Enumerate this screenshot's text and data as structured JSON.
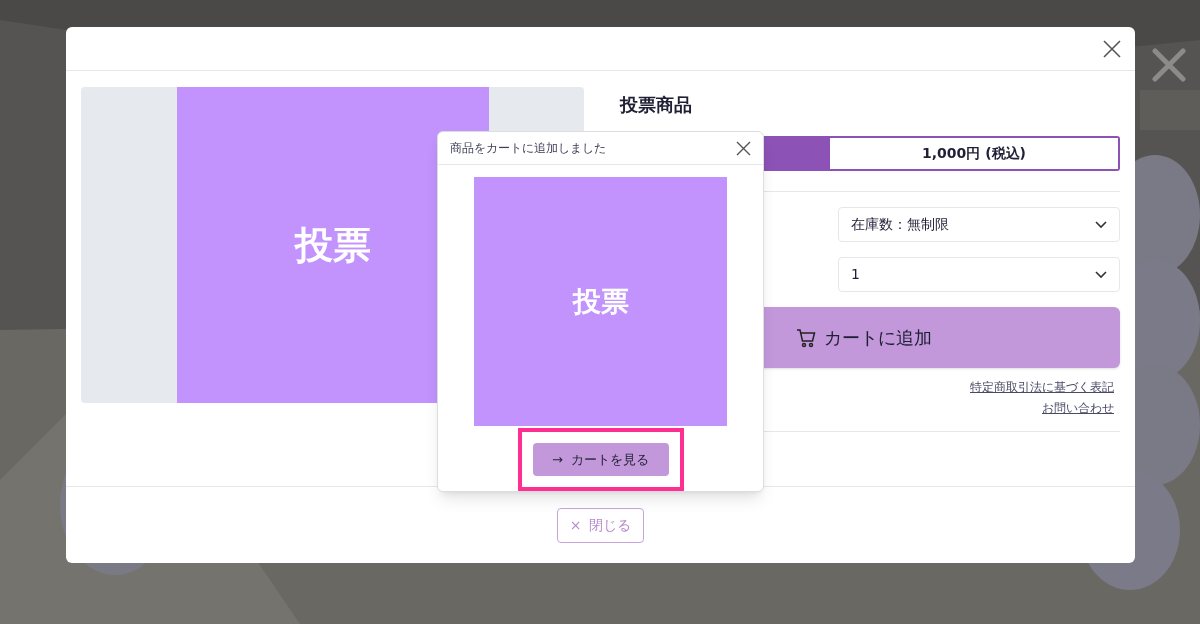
{
  "modal": {
    "product_image_text": "投票",
    "title": "投票商品",
    "price": "1,000円 (税込)",
    "stock_select": "在庫数：無制限",
    "quantity_select": "1",
    "add_to_cart": "カートに追加",
    "links": [
      "特定商取引法に基づく表記",
      "お問い合わせ"
    ],
    "close_button": {
      "icon": "×",
      "label": "閉じる"
    }
  },
  "popup": {
    "title": "商品をカートに追加しました",
    "image_text": "投票",
    "button": {
      "icon": "→",
      "label": "カートを見る"
    },
    "highlighted": true
  }
}
